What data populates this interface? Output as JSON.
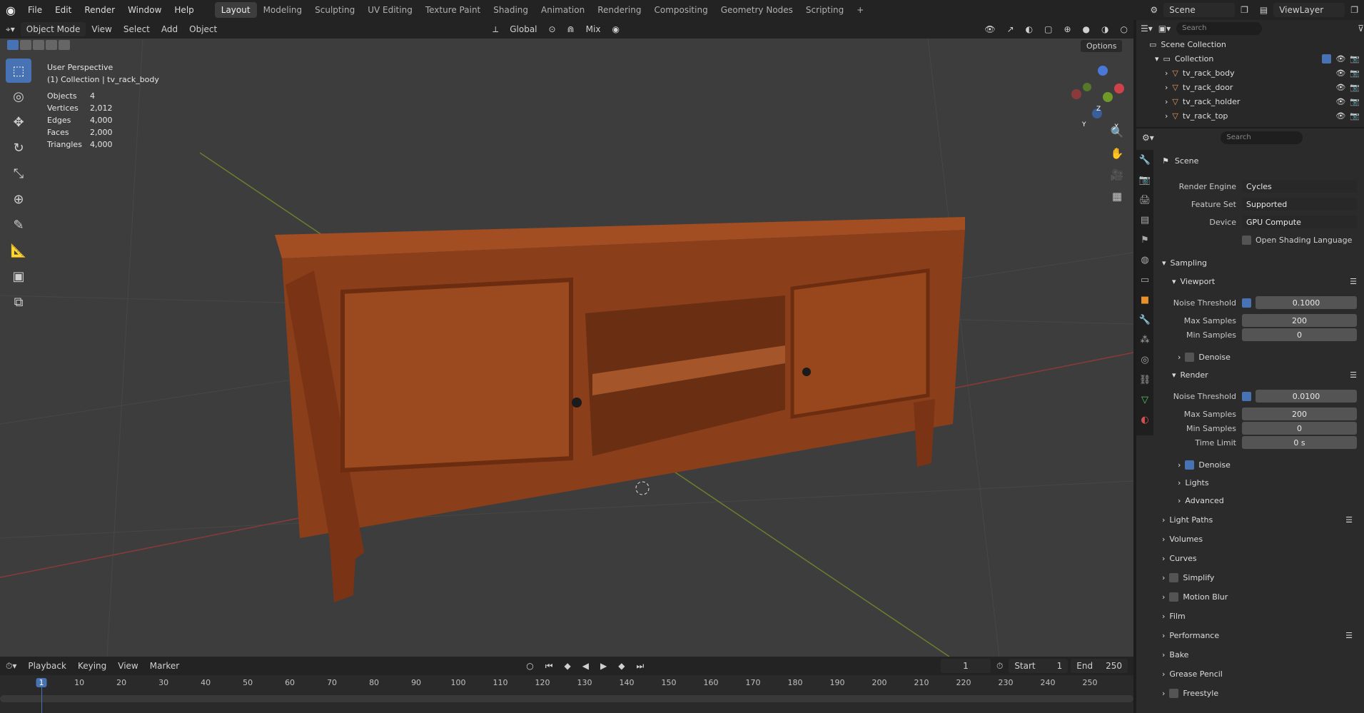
{
  "topbar": {
    "menus": [
      "File",
      "Edit",
      "Render",
      "Window",
      "Help"
    ],
    "workspaces": [
      "Layout",
      "Modeling",
      "Sculpting",
      "UV Editing",
      "Texture Paint",
      "Shading",
      "Animation",
      "Rendering",
      "Compositing",
      "Geometry Nodes",
      "Scripting"
    ],
    "active_workspace": "Layout",
    "add_tab": "+",
    "scene": "Scene",
    "view_layer": "ViewLayer"
  },
  "viewport_header": {
    "mode": "Object Mode",
    "menus": [
      "View",
      "Select",
      "Add",
      "Object"
    ],
    "transform_orientation": "Global",
    "snap_mode": "Mix",
    "options": "Options"
  },
  "viewport": {
    "view_name": "User Perspective",
    "collection_info": "(1) Collection | tv_rack_body",
    "stats": [
      {
        "label": "Objects",
        "value": "4"
      },
      {
        "label": "Vertices",
        "value": "2,012"
      },
      {
        "label": "Edges",
        "value": "4,000"
      },
      {
        "label": "Faces",
        "value": "2,000"
      },
      {
        "label": "Triangles",
        "value": "4,000"
      }
    ],
    "gizmo_axes": [
      "X",
      "Y",
      "Z"
    ]
  },
  "outliner": {
    "search_placeholder": "Search",
    "root": "Scene Collection",
    "collection": "Collection",
    "objects": [
      "tv_rack_body",
      "tv_rack_door",
      "tv_rack_holder",
      "tv_rack_top"
    ]
  },
  "properties": {
    "search_placeholder": "Search",
    "context": "Scene",
    "render_engine_label": "Render Engine",
    "render_engine": "Cycles",
    "feature_set_label": "Feature Set",
    "feature_set": "Supported",
    "device_label": "Device",
    "device": "GPU Compute",
    "osl": "Open Shading Language",
    "sampling": "Sampling",
    "viewport": "Viewport",
    "render": "Render",
    "noise_threshold_label": "Noise Threshold",
    "vp_noise": "0.1000",
    "max_samples_label": "Max Samples",
    "vp_max": "200",
    "min_samples_label": "Min Samples",
    "vp_min": "0",
    "denoise": "Denoise",
    "r_noise": "0.0100",
    "r_max": "200",
    "r_min": "0",
    "time_limit_label": "Time Limit",
    "r_time": "0 s",
    "lights": "Lights",
    "advanced": "Advanced",
    "sections": [
      "Light Paths",
      "Volumes",
      "Curves",
      "Simplify",
      "Motion Blur",
      "Film",
      "Performance",
      "Bake",
      "Grease Pencil",
      "Freestyle"
    ]
  },
  "timeline": {
    "menus": [
      "Playback",
      "Keying",
      "View",
      "Marker"
    ],
    "current_frame": "1",
    "start_label": "Start",
    "start": "1",
    "end_label": "End",
    "end": "250",
    "ticks": [
      "1",
      "10",
      "20",
      "30",
      "40",
      "50",
      "60",
      "70",
      "80",
      "90",
      "100",
      "110",
      "120",
      "130",
      "140",
      "150",
      "160",
      "170",
      "180",
      "190",
      "200",
      "210",
      "220",
      "230",
      "240",
      "250"
    ]
  }
}
